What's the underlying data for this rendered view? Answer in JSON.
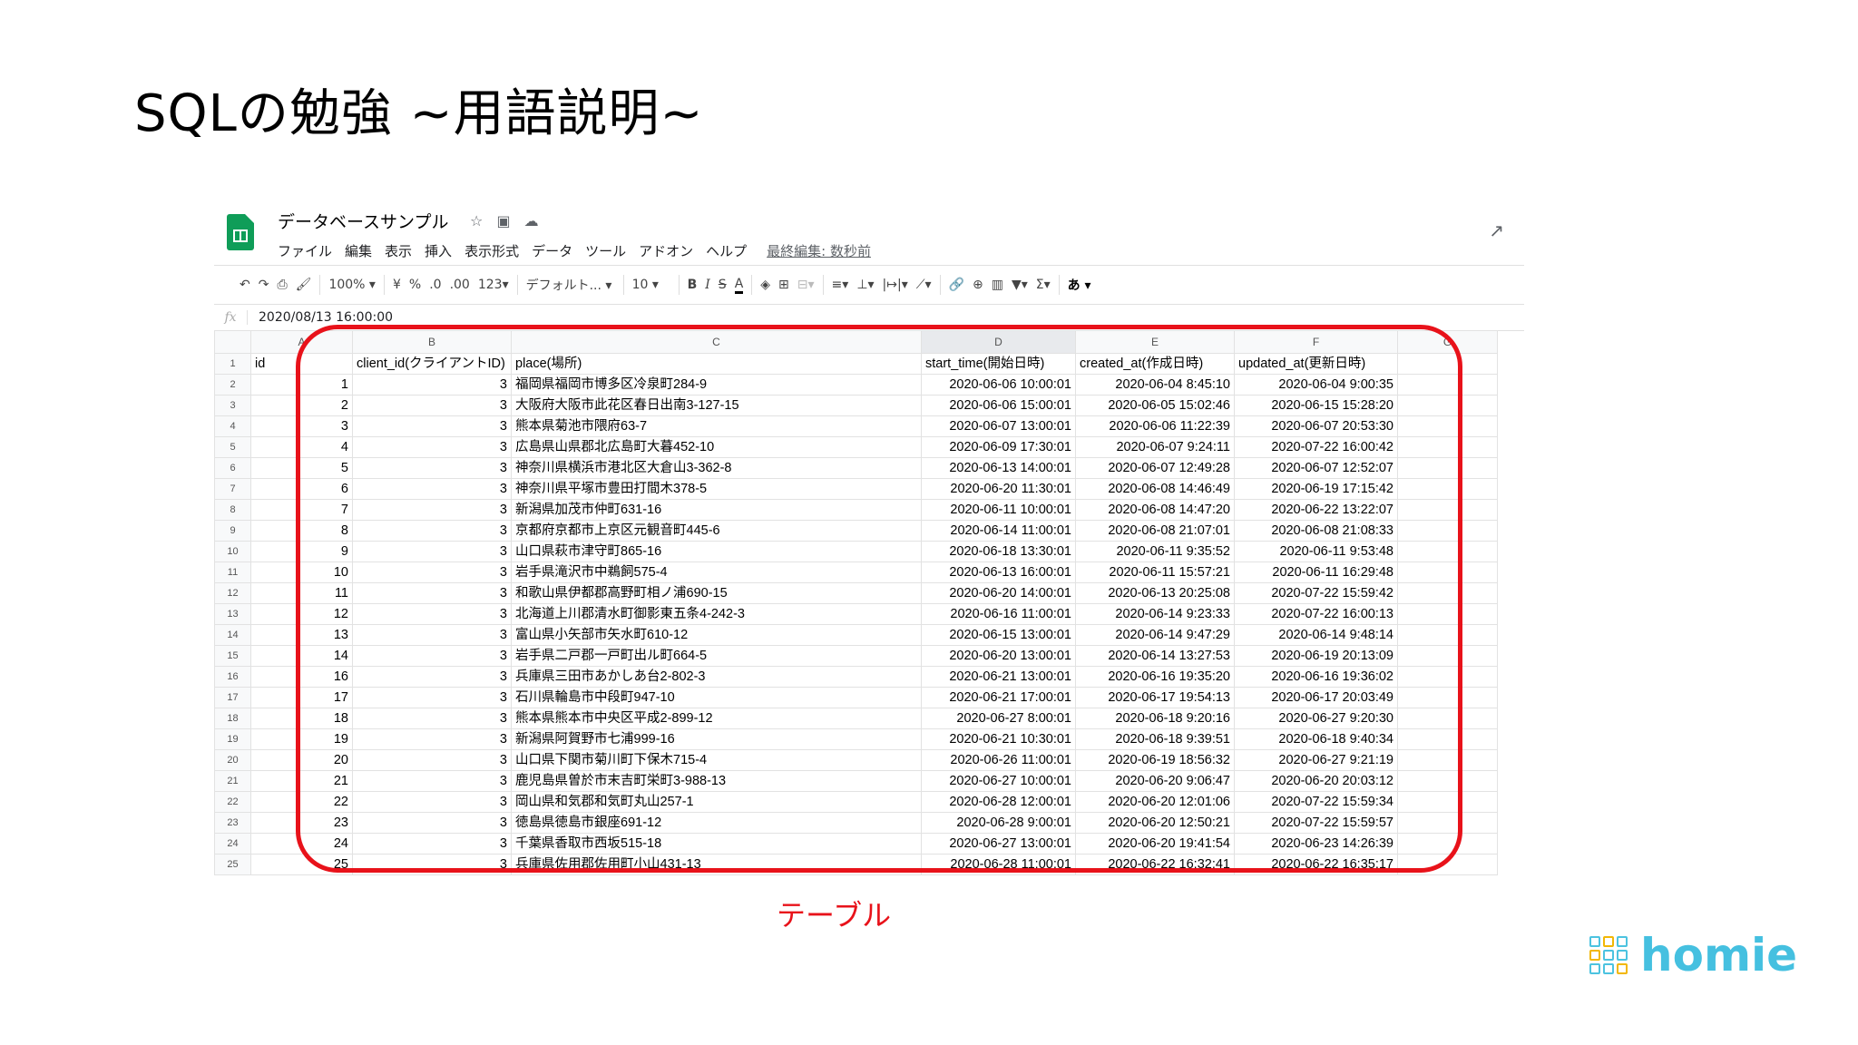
{
  "slide": {
    "title": "SQLの勉強 ~用語説明~",
    "caption": "テーブル",
    "brand": "homie",
    "colors": {
      "highlight": "#e8121a",
      "brand": "#45c0e0",
      "sheets_green": "#0f9d58"
    }
  },
  "spreadsheet": {
    "doc_title": "データベースサンプル",
    "title_icons": [
      "star-icon",
      "move-folder-icon",
      "cloud-status-icon"
    ],
    "menu": [
      "ファイル",
      "編集",
      "表示",
      "挿入",
      "表示形式",
      "データ",
      "ツール",
      "アドオン",
      "ヘルプ"
    ],
    "last_edit": "最終編集: 数秒前",
    "toolbar": {
      "zoom": "100%",
      "currency": "¥",
      "percent": "%",
      "decrease_decimal": ".0",
      "increase_decimal": ".00",
      "more_formats": "123",
      "font": "デフォルト...",
      "font_size": "10",
      "bold": "B",
      "italic": "I",
      "strikethrough": "S",
      "text_color": "A",
      "input_tools": "あ"
    },
    "formula_bar": {
      "fx": "fx",
      "value": "2020/08/13 16:00:00"
    },
    "columns": [
      "A",
      "B",
      "C",
      "D",
      "E",
      "F",
      "G"
    ],
    "headers": [
      "id",
      "client_id(クライアントID)",
      "place(場所)",
      "start_time(開始日時)",
      "created_at(作成日時)",
      "updated_at(更新日時)"
    ],
    "rows": [
      [
        "1",
        "3",
        "福岡県福岡市博多区冷泉町284-9",
        "2020-06-06 10:00:01",
        "2020-06-04 8:45:10",
        "2020-06-04 9:00:35"
      ],
      [
        "2",
        "3",
        "大阪府大阪市此花区春日出南3-127-15",
        "2020-06-06 15:00:01",
        "2020-06-05 15:02:46",
        "2020-06-15 15:28:20"
      ],
      [
        "3",
        "3",
        "熊本県菊池市隈府63-7",
        "2020-06-07 13:00:01",
        "2020-06-06 11:22:39",
        "2020-06-07 20:53:30"
      ],
      [
        "4",
        "3",
        "広島県山県郡北広島町大暮452-10",
        "2020-06-09 17:30:01",
        "2020-06-07 9:24:11",
        "2020-07-22 16:00:42"
      ],
      [
        "5",
        "3",
        "神奈川県横浜市港北区大倉山3-362-8",
        "2020-06-13 14:00:01",
        "2020-06-07 12:49:28",
        "2020-06-07 12:52:07"
      ],
      [
        "6",
        "3",
        "神奈川県平塚市豊田打間木378-5",
        "2020-06-20 11:30:01",
        "2020-06-08 14:46:49",
        "2020-06-19 17:15:42"
      ],
      [
        "7",
        "3",
        "新潟県加茂市仲町631-16",
        "2020-06-11 10:00:01",
        "2020-06-08 14:47:20",
        "2020-06-22 13:22:07"
      ],
      [
        "8",
        "3",
        "京都府京都市上京区元観音町445-6",
        "2020-06-14 11:00:01",
        "2020-06-08 21:07:01",
        "2020-06-08 21:08:33"
      ],
      [
        "9",
        "3",
        "山口県萩市津守町865-16",
        "2020-06-18 13:30:01",
        "2020-06-11 9:35:52",
        "2020-06-11 9:53:48"
      ],
      [
        "10",
        "3",
        "岩手県滝沢市中鵜飼575-4",
        "2020-06-13 16:00:01",
        "2020-06-11 15:57:21",
        "2020-06-11 16:29:48"
      ],
      [
        "11",
        "3",
        "和歌山県伊都郡高野町相ノ浦690-15",
        "2020-06-20 14:00:01",
        "2020-06-13 20:25:08",
        "2020-07-22 15:59:42"
      ],
      [
        "12",
        "3",
        "北海道上川郡清水町御影東五条4-242-3",
        "2020-06-16 11:00:01",
        "2020-06-14 9:23:33",
        "2020-07-22 16:00:13"
      ],
      [
        "13",
        "3",
        "富山県小矢部市矢水町610-12",
        "2020-06-15 13:00:01",
        "2020-06-14 9:47:29",
        "2020-06-14 9:48:14"
      ],
      [
        "14",
        "3",
        "岩手県二戸郡一戸町出ル町664-5",
        "2020-06-20 13:00:01",
        "2020-06-14 13:27:53",
        "2020-06-19 20:13:09"
      ],
      [
        "16",
        "3",
        "兵庫県三田市あかしあ台2-802-3",
        "2020-06-21 13:00:01",
        "2020-06-16 19:35:20",
        "2020-06-16 19:36:02"
      ],
      [
        "17",
        "3",
        "石川県輪島市中段町947-10",
        "2020-06-21 17:00:01",
        "2020-06-17 19:54:13",
        "2020-06-17 20:03:49"
      ],
      [
        "18",
        "3",
        "熊本県熊本市中央区平成2-899-12",
        "2020-06-27 8:00:01",
        "2020-06-18 9:20:16",
        "2020-06-27 9:20:30"
      ],
      [
        "19",
        "3",
        "新潟県阿賀野市七浦999-16",
        "2020-06-21 10:30:01",
        "2020-06-18 9:39:51",
        "2020-06-18 9:40:34"
      ],
      [
        "20",
        "3",
        "山口県下関市菊川町下保木715-4",
        "2020-06-26 11:00:01",
        "2020-06-19 18:56:32",
        "2020-06-27 9:21:19"
      ],
      [
        "21",
        "3",
        "鹿児島県曽於市末吉町栄町3-988-13",
        "2020-06-27 10:00:01",
        "2020-06-20 9:06:47",
        "2020-06-20 20:03:12"
      ],
      [
        "22",
        "3",
        "岡山県和気郡和気町丸山257-1",
        "2020-06-28 12:00:01",
        "2020-06-20 12:01:06",
        "2020-07-22 15:59:34"
      ],
      [
        "23",
        "3",
        "徳島県徳島市銀座691-12",
        "2020-06-28 9:00:01",
        "2020-06-20 12:50:21",
        "2020-07-22 15:59:57"
      ],
      [
        "24",
        "3",
        "千葉県香取市西坂515-18",
        "2020-06-27 13:00:01",
        "2020-06-20 19:41:54",
        "2020-06-23 14:26:39"
      ],
      [
        "25",
        "3",
        "兵庫県佐用郡佐用町小山431-13",
        "2020-06-28 11:00:01",
        "2020-06-22 16:32:41",
        "2020-06-22 16:35:17"
      ]
    ]
  }
}
